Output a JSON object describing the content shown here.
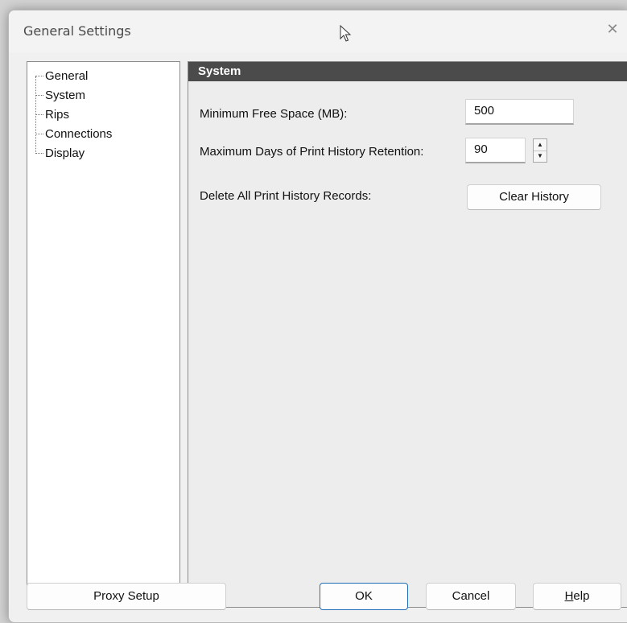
{
  "window": {
    "title": "General Settings",
    "close_glyph": "✕"
  },
  "tree": {
    "items": [
      {
        "label": "General",
        "selected": false
      },
      {
        "label": "System",
        "selected": true
      },
      {
        "label": "Rips",
        "selected": false
      },
      {
        "label": "Connections",
        "selected": false
      },
      {
        "label": "Display",
        "selected": false
      }
    ]
  },
  "panel": {
    "header": "System",
    "min_free_space": {
      "label": "Minimum Free Space (MB):",
      "value": "500"
    },
    "max_days": {
      "label": "Maximum Days of Print History Retention:",
      "value": "90",
      "up_glyph": "▲",
      "down_glyph": "▼"
    },
    "delete_history": {
      "label": "Delete All Print History Records:",
      "button": "Clear History"
    }
  },
  "footer": {
    "proxy_setup": "Proxy Setup",
    "ok": "OK",
    "cancel": "Cancel",
    "help_first": "H",
    "help_rest": "elp"
  },
  "icons": {
    "cursor": "mouse-pointer-icon",
    "close": "close-icon"
  },
  "colors": {
    "panel_header_bg": "#4b4b4b",
    "default_button_border": "#1f6fb8"
  }
}
